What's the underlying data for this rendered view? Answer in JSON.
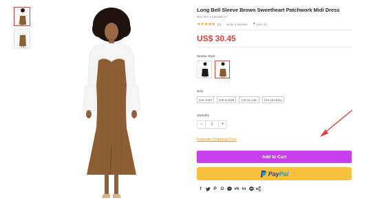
{
  "product": {
    "title": "Long Bell Sleeve Brown Sweetheart Patchwork Midi Dress",
    "item_no": "Item NO: LC61054-17",
    "rating_count": "(0)",
    "write_review": "Write a Review",
    "like": "Like (0)",
    "price": "US$ 30.45"
  },
  "similar_style": {
    "label": "Similar Style"
  },
  "size": {
    "label": "Size",
    "options": [
      "(US 4-6)S",
      "(US 8-10)M",
      "(US 12-14)L",
      "(US 16-18)XL"
    ]
  },
  "quantity": {
    "label": "Quantity",
    "value": "1",
    "minus": "−",
    "plus": "+"
  },
  "shipping_link": "Estimate Shipping Cost",
  "add_to_cart": "Add to Cart",
  "paypal": {
    "pay": "Pay",
    "pal": "Pal"
  },
  "share_icons": [
    "facebook-icon",
    "twitter-icon",
    "pinterest-icon",
    "google-plus-icon",
    "messenger-icon",
    "vk-icon",
    "linkedin-icon",
    "line-icon",
    "share-icon"
  ],
  "colors": {
    "accent": "#c83ff0",
    "price": "#e0403a",
    "paypal_bg": "#f7c13a",
    "link": "#e89a2a",
    "annotation_arrow": "#e0403a"
  }
}
